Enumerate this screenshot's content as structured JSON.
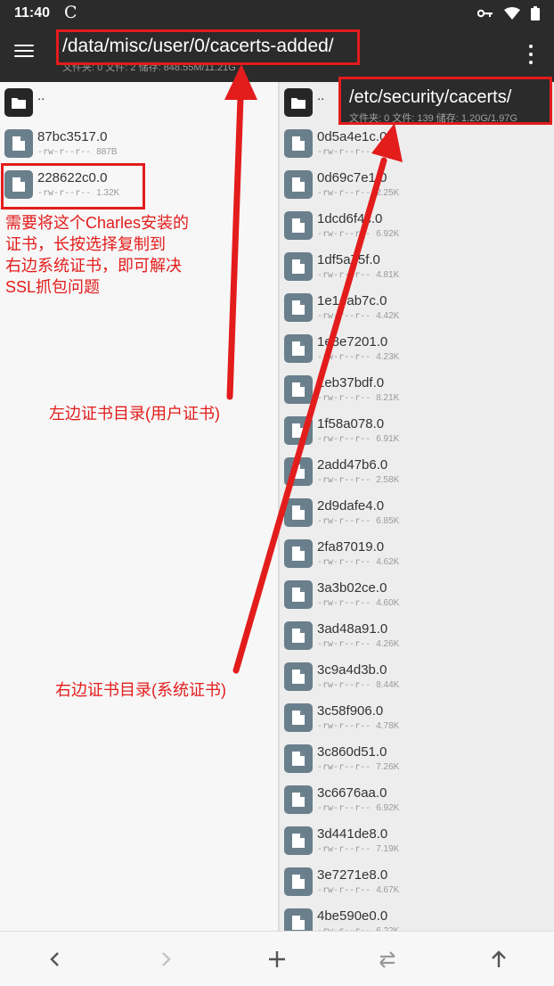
{
  "status_bar": {
    "time": "11:40",
    "app_glyph": "C",
    "icons": [
      "key-icon",
      "wifi-icon",
      "battery-icon"
    ]
  },
  "toolbar": {
    "path": "/data/misc/user/0/cacerts-added/",
    "stats": "文件夹: 0  文件: 2  储存: 848.55M/11.21G",
    "menu_icon": "hamburger-menu-icon",
    "overflow_icon": "more-vert-icon"
  },
  "left_pane": {
    "items": [
      {
        "type": "folder",
        "name": "..",
        "perm": "",
        "size": ""
      },
      {
        "type": "file",
        "name": "87bc3517.0",
        "perm": "-rw-r--r--",
        "size": "887B"
      },
      {
        "type": "file",
        "name": "228622c0.0",
        "perm": "-rw-r--r--",
        "size": "1.32K"
      }
    ]
  },
  "right_pane": {
    "path": "/etc/security/cacerts/",
    "stats": "文件夹: 0  文件: 139  储存: 1.20G/1.97G",
    "items": [
      {
        "type": "folder",
        "name": "..",
        "perm": "",
        "size": ""
      },
      {
        "type": "file",
        "name": "0d5a4e1c.0",
        "perm": "-rw-r--r--",
        "size": "1.83K"
      },
      {
        "type": "file",
        "name": "0d69c7e1.0",
        "perm": "-rw-r--r--",
        "size": "2.25K"
      },
      {
        "type": "file",
        "name": "1dcd6f4c.0",
        "perm": "-rw-r--r--",
        "size": "6.92K"
      },
      {
        "type": "file",
        "name": "1df5a75f.0",
        "perm": "-rw-r--r--",
        "size": "4.81K"
      },
      {
        "type": "file",
        "name": "1e1eab7c.0",
        "perm": "-rw-r--r--",
        "size": "4.42K"
      },
      {
        "type": "file",
        "name": "1e8e7201.0",
        "perm": "-rw-r--r--",
        "size": "4.23K"
      },
      {
        "type": "file",
        "name": "1eb37bdf.0",
        "perm": "-rw-r--r--",
        "size": "8.21K"
      },
      {
        "type": "file",
        "name": "1f58a078.0",
        "perm": "-rw-r--r--",
        "size": "6.91K"
      },
      {
        "type": "file",
        "name": "2add47b6.0",
        "perm": "-rw-r--r--",
        "size": "2.58K"
      },
      {
        "type": "file",
        "name": "2d9dafe4.0",
        "perm": "-rw-r--r--",
        "size": "6.85K"
      },
      {
        "type": "file",
        "name": "2fa87019.0",
        "perm": "-rw-r--r--",
        "size": "4.62K"
      },
      {
        "type": "file",
        "name": "3a3b02ce.0",
        "perm": "-rw-r--r--",
        "size": "4.60K"
      },
      {
        "type": "file",
        "name": "3ad48a91.0",
        "perm": "-rw-r--r--",
        "size": "4.26K"
      },
      {
        "type": "file",
        "name": "3c9a4d3b.0",
        "perm": "-rw-r--r--",
        "size": "8.44K"
      },
      {
        "type": "file",
        "name": "3c58f906.0",
        "perm": "-rw-r--r--",
        "size": "4.78K"
      },
      {
        "type": "file",
        "name": "3c860d51.0",
        "perm": "-rw-r--r--",
        "size": "7.26K"
      },
      {
        "type": "file",
        "name": "3c6676aa.0",
        "perm": "-rw-r--r--",
        "size": "6.92K"
      },
      {
        "type": "file",
        "name": "3d441de8.0",
        "perm": "-rw-r--r--",
        "size": "7.19K"
      },
      {
        "type": "file",
        "name": "3e7271e8.0",
        "perm": "-rw-r--r--",
        "size": "4.67K"
      },
      {
        "type": "file",
        "name": "4be590e0.0",
        "perm": "-rw-r--r--",
        "size": "6.22K"
      }
    ]
  },
  "annotations": {
    "note_main": [
      "需要将这个Charles安装的",
      "证书，长按选择复制到",
      "右边系统证书，即可解决",
      "SSL抓包问题"
    ],
    "note_left": "左边证书目录(用户证书)",
    "note_right": "右边证书目录(系统证书)",
    "color": "#e31c1c"
  },
  "bottom_bar": {
    "buttons": [
      "back-chevron-icon",
      "forward-chevron-icon",
      "add-icon",
      "swap-icon",
      "up-arrow-icon"
    ]
  },
  "colors": {
    "toolbar": "#2b2b2b",
    "file_icon": "#6a7f8c",
    "folder_icon": "#262626",
    "annotation": "#e31c1c"
  }
}
